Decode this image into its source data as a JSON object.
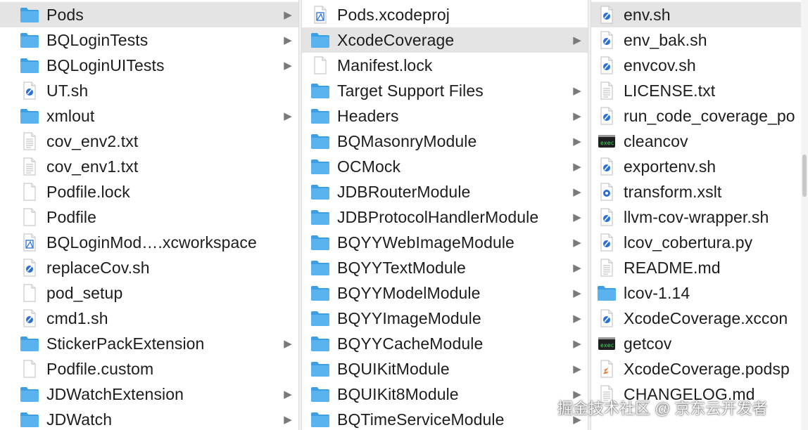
{
  "colors": {
    "folder": "#5ab3ee",
    "folder_dark": "#3d9ee3",
    "selected_bg": "#e4e4e4",
    "script_blue": "#2b6fd6",
    "terminal": "#1f1f1f",
    "swift_orange": "#f07a2b"
  },
  "columns": [
    {
      "items": [
        {
          "label": "Pods",
          "icon": "folder-icon",
          "chevron": true,
          "selected": true
        },
        {
          "label": "BQLoginTests",
          "icon": "folder-icon",
          "chevron": true
        },
        {
          "label": "BQLoginUITests",
          "icon": "folder-icon",
          "chevron": true
        },
        {
          "label": "UT.sh",
          "icon": "shell-script-icon",
          "chevron": false
        },
        {
          "label": "xmlout",
          "icon": "folder-icon",
          "chevron": true
        },
        {
          "label": "cov_env2.txt",
          "icon": "text-document-icon",
          "chevron": false
        },
        {
          "label": "cov_env1.txt",
          "icon": "text-document-icon",
          "chevron": false
        },
        {
          "label": "Podfile.lock",
          "icon": "blank-document-icon",
          "chevron": false
        },
        {
          "label": "Podfile",
          "icon": "blank-document-icon",
          "chevron": false
        },
        {
          "label": "BQLoginMod….xcworkspace",
          "icon": "xcode-workspace-icon",
          "chevron": false
        },
        {
          "label": "replaceCov.sh",
          "icon": "shell-script-icon",
          "chevron": false
        },
        {
          "label": "pod_setup",
          "icon": "blank-document-icon",
          "chevron": false
        },
        {
          "label": "cmd1.sh",
          "icon": "shell-script-icon",
          "chevron": false
        },
        {
          "label": "StickerPackExtension",
          "icon": "folder-icon",
          "chevron": true
        },
        {
          "label": "Podfile.custom",
          "icon": "blank-document-icon",
          "chevron": false
        },
        {
          "label": "JDWatchExtension",
          "icon": "folder-icon",
          "chevron": true
        },
        {
          "label": "JDWatch",
          "icon": "folder-icon",
          "chevron": true
        }
      ]
    },
    {
      "items": [
        {
          "label": "Pods.xcodeproj",
          "icon": "xcode-project-icon",
          "chevron": false
        },
        {
          "label": "XcodeCoverage",
          "icon": "folder-icon",
          "chevron": true,
          "selected": true
        },
        {
          "label": "Manifest.lock",
          "icon": "blank-document-icon",
          "chevron": false
        },
        {
          "label": "Target Support Files",
          "icon": "folder-icon",
          "chevron": true
        },
        {
          "label": "Headers",
          "icon": "folder-icon",
          "chevron": true
        },
        {
          "label": "BQMasonryModule",
          "icon": "folder-icon",
          "chevron": true
        },
        {
          "label": "OCMock",
          "icon": "folder-icon",
          "chevron": true
        },
        {
          "label": "JDBRouterModule",
          "icon": "folder-icon",
          "chevron": true
        },
        {
          "label": "JDBProtocolHandlerModule",
          "icon": "folder-icon",
          "chevron": true
        },
        {
          "label": "BQYYWebImageModule",
          "icon": "folder-icon",
          "chevron": true
        },
        {
          "label": "BQYYTextModule",
          "icon": "folder-icon",
          "chevron": true
        },
        {
          "label": "BQYYModelModule",
          "icon": "folder-icon",
          "chevron": true
        },
        {
          "label": "BQYYImageModule",
          "icon": "folder-icon",
          "chevron": true
        },
        {
          "label": "BQYYCacheModule",
          "icon": "folder-icon",
          "chevron": true
        },
        {
          "label": "BQUIKitModule",
          "icon": "folder-icon",
          "chevron": true
        },
        {
          "label": "BQUIKit8Module",
          "icon": "folder-icon",
          "chevron": true
        },
        {
          "label": "BQTimeServiceModule",
          "icon": "folder-icon",
          "chevron": true
        }
      ]
    },
    {
      "items": [
        {
          "label": "env.sh",
          "icon": "shell-script-icon",
          "chevron": false,
          "selected": true
        },
        {
          "label": "env_bak.sh",
          "icon": "shell-script-icon",
          "chevron": false
        },
        {
          "label": "envcov.sh",
          "icon": "shell-script-icon",
          "chevron": false
        },
        {
          "label": "LICENSE.txt",
          "icon": "text-document-icon",
          "chevron": false
        },
        {
          "label": "run_code_coverage_po",
          "icon": "shell-script-icon",
          "chevron": false
        },
        {
          "label": "cleancov",
          "icon": "terminal-exec-icon",
          "chevron": false
        },
        {
          "label": "exportenv.sh",
          "icon": "shell-script-icon",
          "chevron": false
        },
        {
          "label": "transform.xslt",
          "icon": "xslt-document-icon",
          "chevron": false
        },
        {
          "label": "llvm-cov-wrapper.sh",
          "icon": "shell-script-icon",
          "chevron": false
        },
        {
          "label": "lcov_cobertura.py",
          "icon": "shell-script-icon",
          "chevron": false
        },
        {
          "label": "README.md",
          "icon": "text-document-icon",
          "chevron": false
        },
        {
          "label": "lcov-1.14",
          "icon": "folder-icon",
          "chevron": false
        },
        {
          "label": "XcodeCoverage.xccon",
          "icon": "shell-script-icon",
          "chevron": false
        },
        {
          "label": "getcov",
          "icon": "terminal-exec-icon",
          "chevron": false
        },
        {
          "label": "XcodeCoverage.podsp",
          "icon": "swift-document-icon",
          "chevron": false
        },
        {
          "label": "CHANGELOG.md",
          "icon": "text-document-icon",
          "chevron": false
        }
      ]
    }
  ],
  "chevron_glyph": "▶",
  "watermark": "掘金技术社区 @ 京东云开发者"
}
